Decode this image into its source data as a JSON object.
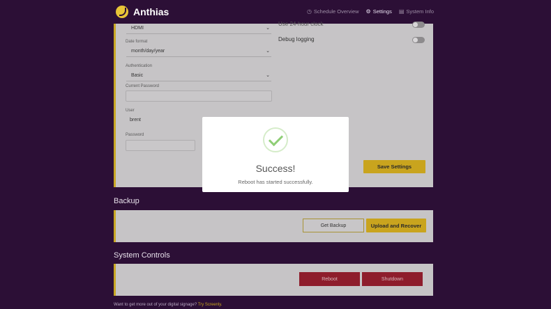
{
  "app": {
    "name": "Anthias"
  },
  "nav": [
    {
      "label": "Schedule Overview",
      "icon": "clock-icon"
    },
    {
      "label": "Settings",
      "icon": "gear-icon",
      "active": true
    },
    {
      "label": "System Info",
      "icon": "system-info-icon"
    }
  ],
  "settings": {
    "output_value": "HDMI",
    "date_format_label": "Date format",
    "date_format_value": "month/day/year",
    "auth_label": "Authentication",
    "auth_value": "Basic",
    "current_password_label": "Current Password",
    "current_password_value": "",
    "user_label": "User",
    "user_value": "brent",
    "password_label": "Password",
    "password_value": "",
    "use_24_hour_label": "Use 24-hour clock",
    "debug_logging_label": "Debug logging",
    "save_label": "Save Settings"
  },
  "backup": {
    "title": "Backup",
    "get_backup_label": "Get Backup",
    "upload_recover_label": "Upload and Recover"
  },
  "system_controls": {
    "title": "System Controls",
    "reboot_label": "Reboot",
    "shutdown_label": "Shutdown"
  },
  "footer": {
    "text": "Want to get more out of your digital signage? ",
    "link": "Try Screenly."
  },
  "modal": {
    "title": "Success!",
    "message": "Reboot has started successfully."
  },
  "colors": {
    "background": "#2c0f36",
    "accent_yellow": "#e8c437",
    "danger": "#8e1d2c",
    "success": "#8fce76"
  }
}
